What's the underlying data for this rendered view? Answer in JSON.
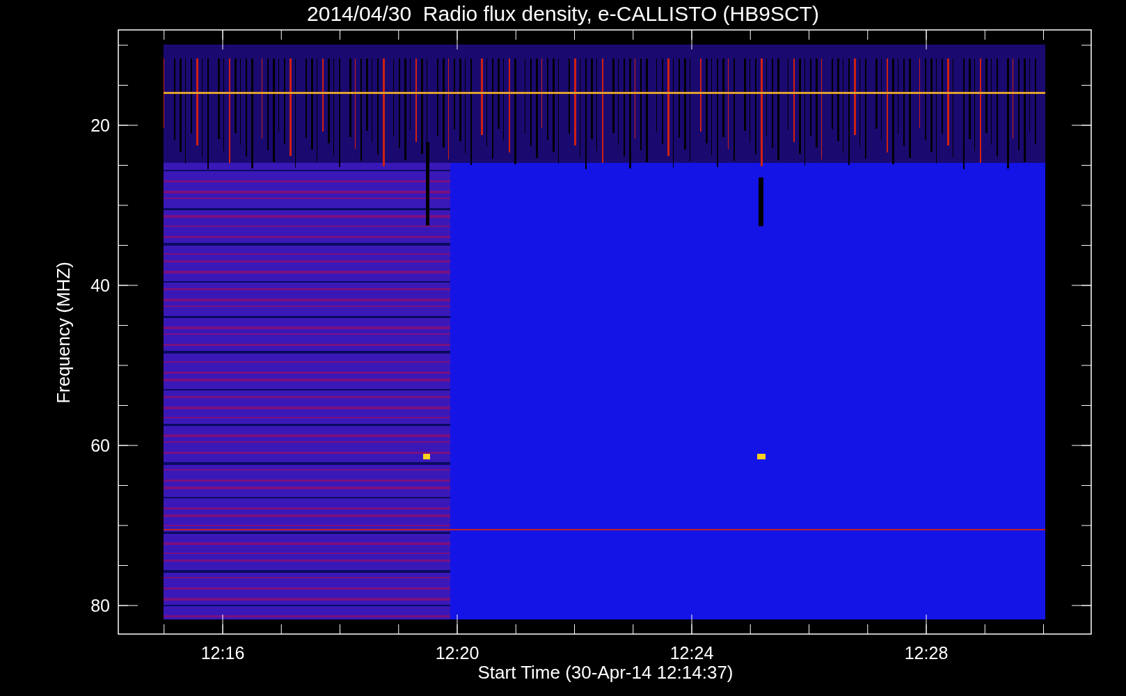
{
  "title": "2014/04/30  Radio flux density, e-CALLISTO (HB9SCT)",
  "y_axis": {
    "label": "Frequency (MHZ)",
    "ticks": [
      "20",
      "40",
      "60",
      "80"
    ]
  },
  "x_axis": {
    "label": "Start Time (30-Apr-14 12:14:37)",
    "ticks": [
      "12:16",
      "12:20",
      "12:24",
      "12:28"
    ]
  }
}
